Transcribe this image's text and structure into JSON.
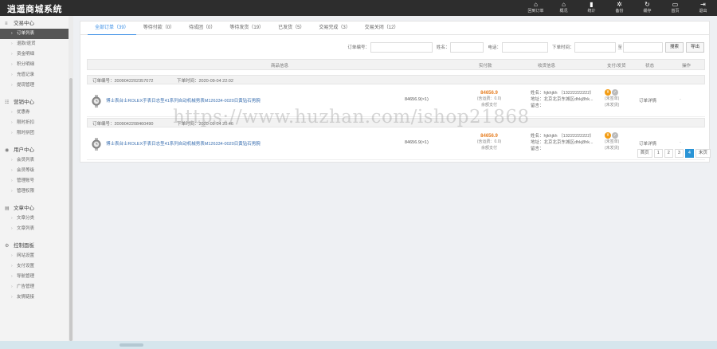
{
  "app": {
    "title": "逍遥商城系统"
  },
  "topbar": {
    "tools": [
      {
        "icon": "home-icon",
        "glyph": "⌂",
        "label": "回到订单"
      },
      {
        "icon": "home-icon",
        "glyph": "⌂",
        "label": "概况"
      },
      {
        "icon": "chart-icon",
        "glyph": "▮",
        "label": "统计"
      },
      {
        "icon": "gear-icon",
        "glyph": "✲",
        "label": "备份"
      },
      {
        "icon": "refresh-icon",
        "glyph": "↻",
        "label": "缓存"
      },
      {
        "icon": "monitor-icon",
        "glyph": "▭",
        "label": "首页"
      },
      {
        "icon": "logout-icon",
        "glyph": "⇥",
        "label": "退出"
      }
    ]
  },
  "sidebar": {
    "groups": [
      {
        "title": "交易中心",
        "items": [
          "订单列表",
          "退款/退货",
          "资金明细",
          "积分明细",
          "充值记录",
          "提现管理"
        ]
      },
      {
        "title": "营销中心",
        "items": [
          "优惠券",
          "限时折扣",
          "限时拼团"
        ]
      },
      {
        "title": "用户中心",
        "items": [
          "会员列表",
          "会员等级",
          "管理账号",
          "管理权限"
        ]
      },
      {
        "title": "文章中心",
        "items": [
          "文章分类",
          "文章列表"
        ]
      },
      {
        "title": "控制面板",
        "items": [
          "网站设置",
          "支付设置",
          "导航管理",
          "广告管理",
          "友情链接"
        ]
      }
    ]
  },
  "tabs": [
    "全部订单（39）",
    "等待付款（0）",
    "待成团（0）",
    "等待发货（19）",
    "已发货（5）",
    "交易完成（3）",
    "交易关闭（12）"
  ],
  "filters": {
    "order_no_label": "订单编号：",
    "name_label": "姓名：",
    "phone_label": "电话：",
    "time_label": "下单时间：",
    "to_label": "至",
    "search_button": "搜索",
    "export_button": "导出"
  },
  "table_header": {
    "product": "商品信息",
    "paid": "实付款",
    "receiver": "收货信息",
    "status": "支付/发货",
    "state": "状态",
    "action": "操作"
  },
  "orders": [
    {
      "order_no": "订单编号：2009042202357072",
      "order_time": "下单时间：2020-09-04 22:02",
      "product": "博士表台士ROLEX手表日志型41系列自动机械男表M126334-0020日黄钻石男腕",
      "price": "84656.9(×1)",
      "paid": "84656.9",
      "shipping": "(含运费：0.0)",
      "pay_method": "余额支付",
      "receiver_name": "姓名：hjkhjkh （13222222222）",
      "receiver_addr": "地址：北京北京东城区dhkj8hk...",
      "receiver_note": "留言：",
      "pay_status": "(未签单)",
      "ship_status": "(未发货)",
      "detail": "订单详情",
      "op": "-"
    },
    {
      "order_no": "订单编号：2009042208460490",
      "order_time": "下单时间：2020-09-04 20:46",
      "product": "博士表台士ROLEX手表日志型41系列自动机械男表M126334-0020日黄钻石男腕",
      "price": "84656.9(×1)",
      "paid": "84656.9",
      "shipping": "(含运费：0.0)",
      "pay_method": "余额支付",
      "receiver_name": "姓名：hjkhjkh （13222222222）",
      "receiver_addr": "地址：北京北京东城区dhkj8hk...",
      "receiver_note": "留言：",
      "pay_status": "(未签单)",
      "ship_status": "(未发货)",
      "detail": "订单详情",
      "op": "-"
    }
  ],
  "pager": [
    "首页",
    "1",
    "2",
    "3",
    "4",
    "末页"
  ],
  "pager_current": "4",
  "watermark": "https://www.huzhan.com/ishop21868",
  "colors": {
    "accent": "#3a8ee6",
    "price": "#e67e22",
    "topbar": "#2d2d2d",
    "pager_active": "#2a94d6"
  }
}
